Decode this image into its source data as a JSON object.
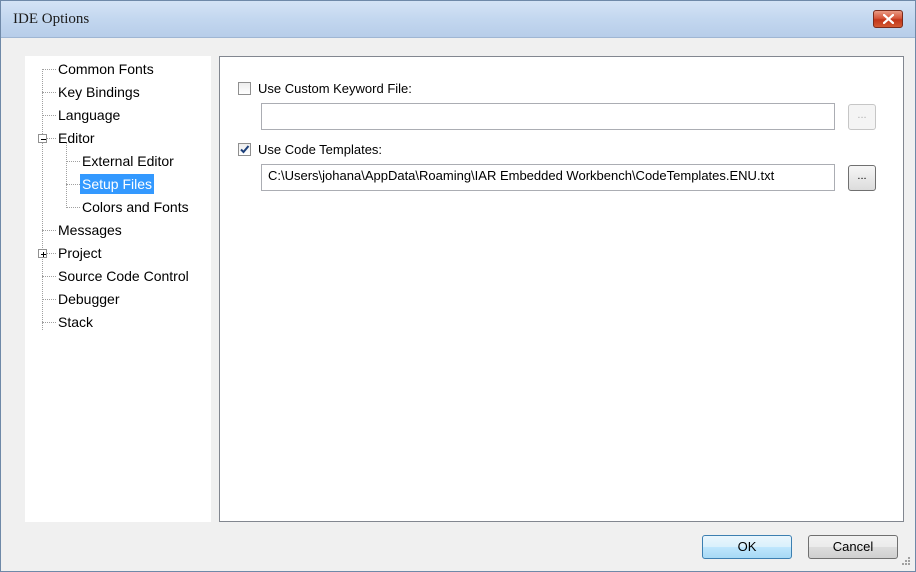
{
  "window": {
    "title": "IDE Options"
  },
  "tree": {
    "items": [
      {
        "label": "Common Fonts"
      },
      {
        "label": "Key Bindings"
      },
      {
        "label": "Language"
      },
      {
        "label": "Editor"
      },
      {
        "label": "External Editor"
      },
      {
        "label": "Setup Files",
        "selected": true
      },
      {
        "label": "Colors and Fonts"
      },
      {
        "label": "Messages"
      },
      {
        "label": "Project"
      },
      {
        "label": "Source Code Control"
      },
      {
        "label": "Debugger"
      },
      {
        "label": "Stack"
      }
    ]
  },
  "setup_files": {
    "custom_keyword": {
      "label": "Use Custom Keyword File:",
      "checked": false,
      "value": "",
      "browse_label": "..."
    },
    "code_templates": {
      "label": "Use Code Templates:",
      "checked": true,
      "value": "C:\\Users\\johana\\AppData\\Roaming\\IAR Embedded Workbench\\CodeTemplates.ENU.txt",
      "browse_label": "..."
    }
  },
  "buttons": {
    "ok": "OK",
    "cancel": "Cancel"
  },
  "colors": {
    "selection": "#3399ff",
    "title_gradient": "#c3d7ef",
    "close_button": "#c2351a"
  }
}
